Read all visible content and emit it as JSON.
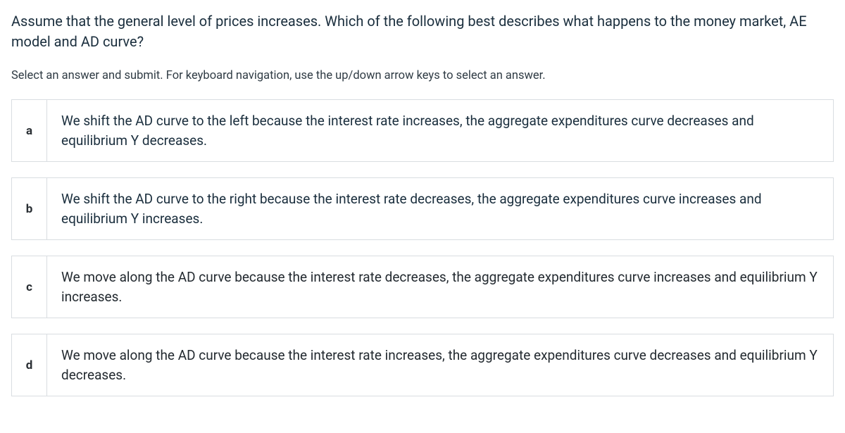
{
  "question": "Assume that the general level of prices increases. Which of the following best describes what happens to the money market, AE model and AD curve?",
  "instruction": "Select an answer and submit. For keyboard navigation, use the up/down arrow keys to select an answer.",
  "options": [
    {
      "letter": "a",
      "text": "We shift the AD curve to the left because the interest rate increases, the aggregate expenditures curve decreases and equilibrium Y decreases."
    },
    {
      "letter": "b",
      "text": "We shift the AD curve to the right because the interest rate decreases, the aggregate expenditures curve increases and equilibrium Y increases."
    },
    {
      "letter": "c",
      "text": "We move along the AD curve because the interest rate decreases, the aggregate expenditures curve increases and equilibrium Y increases."
    },
    {
      "letter": "d",
      "text": "We move along the AD curve because the interest rate increases, the aggregate expenditures curve decreases and equilibrium Y decreases."
    }
  ]
}
